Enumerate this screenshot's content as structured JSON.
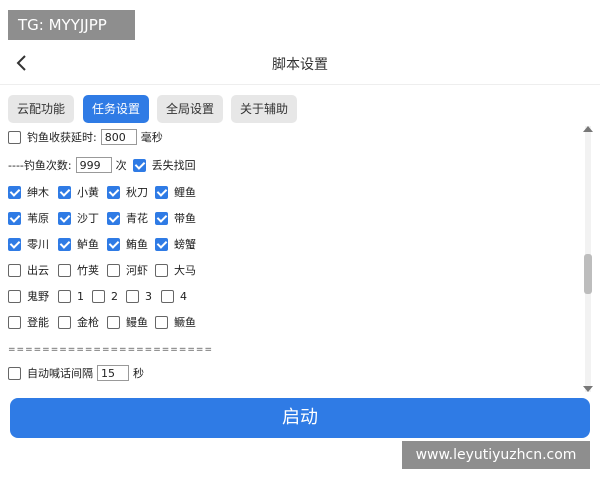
{
  "watermark_top": "TG: MYYJJPP",
  "watermark_bottom": "www.leyutiyuzhcn.com",
  "header": {
    "title": "脚本设置"
  },
  "tabs": [
    {
      "label": "云配功能",
      "active": false
    },
    {
      "label": "任务设置",
      "active": true
    },
    {
      "label": "全局设置",
      "active": false
    },
    {
      "label": "关于辅助",
      "active": false
    }
  ],
  "settings": {
    "delay_label": "钓鱼收获延时:",
    "delay_value": "800",
    "delay_unit": "毫秒",
    "count_label": "----钓鱼次数:",
    "count_value": "999",
    "count_unit": "次",
    "lost_label": "丢失找回",
    "separator": "========================",
    "auto_label": "自动喊话间隔",
    "auto_value": "15",
    "auto_unit": "秒"
  },
  "fish_grid": [
    [
      "绅木",
      "小黄",
      "秋刀",
      "鲤鱼"
    ],
    [
      "苇原",
      "沙丁",
      "青花",
      "带鱼"
    ],
    [
      "零川",
      "鲈鱼",
      "鲔鱼",
      "螃蟹"
    ],
    [
      "出云",
      "竹荚",
      "河虾",
      "大马"
    ],
    [
      "鬼野",
      "1",
      "2",
      "3",
      "4"
    ],
    [
      "登能",
      "金枪",
      "鳗鱼",
      "鳜鱼"
    ]
  ],
  "start_button": "启动",
  "colors": {
    "accent": "#2f7be5",
    "watermark": "#8e8e8e"
  }
}
